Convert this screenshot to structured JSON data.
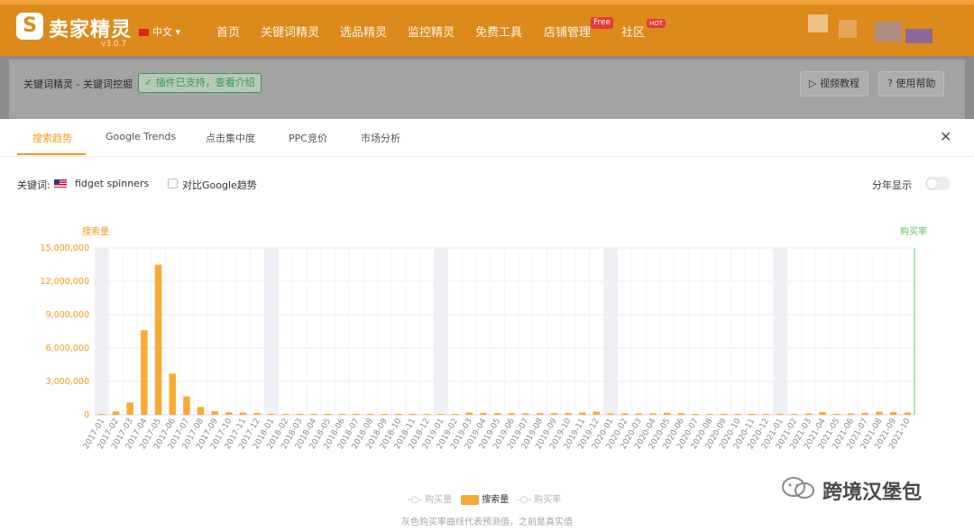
{
  "header": {
    "logo_mark": "S",
    "logo_text": "卖家精灵",
    "version": "v3.0.7",
    "language": "中文",
    "nav": [
      {
        "label": "首页"
      },
      {
        "label": "关键词精灵"
      },
      {
        "label": "选品精灵"
      },
      {
        "label": "监控精灵"
      },
      {
        "label": "免费工具"
      },
      {
        "label": "店铺管理",
        "badge": "Free"
      },
      {
        "label": "社区",
        "badge": "HOT"
      }
    ]
  },
  "subbar": {
    "breadcrumb": "关键词精灵 - 关键词挖掘",
    "plugin_tag": "插件已支持，查看介绍",
    "video_btn": "视频教程",
    "help_btn": "使用帮助"
  },
  "modal": {
    "tabs": [
      "搜索趋势",
      "Google Trends",
      "点击集中度",
      "PPC竞价",
      "市场分析"
    ],
    "active_tab": 0,
    "keyword_label": "关键词:",
    "keyword": "fidget spinners",
    "compare_label": "对比Google趋势",
    "year_toggle_label": "分年显示",
    "legend": [
      "购买量",
      "搜索量",
      "购买率"
    ],
    "footnote": "灰色购买率曲线代表预测值，之前是真实值"
  },
  "chart_data": {
    "type": "bar",
    "y_axis_left_title": "搜索量",
    "y_axis_right_title": "购买率",
    "ylim": [
      0,
      15000000
    ],
    "yticks": [
      "0",
      "3,000,000",
      "6,000,000",
      "9,000,000",
      "12,000,000",
      "15,000,000"
    ],
    "ytick_values": [
      0,
      3000000,
      6000000,
      9000000,
      12000000,
      15000000
    ],
    "series": [
      {
        "name": "搜索量",
        "color": "#f8ab33"
      }
    ],
    "categories": [
      "2017-01",
      "2017-02",
      "2017-03",
      "2017-04",
      "2017-05",
      "2017-06",
      "2017-07",
      "2017-08",
      "2017-09",
      "2017-10",
      "2017-11",
      "2017-12",
      "2018-01",
      "2018-02",
      "2018-03",
      "2018-04",
      "2018-05",
      "2018-06",
      "2018-07",
      "2018-08",
      "2018-09",
      "2018-10",
      "2018-11",
      "2018-12",
      "2019-01",
      "2019-02",
      "2019-03",
      "2019-04",
      "2019-05",
      "2019-06",
      "2019-07",
      "2019-08",
      "2019-09",
      "2019-10",
      "2019-11",
      "2019-12",
      "2020-01",
      "2020-02",
      "2020-03",
      "2020-04",
      "2020-05",
      "2020-06",
      "2020-07",
      "2020-08",
      "2020-09",
      "2020-10",
      "2020-11",
      "2020-12",
      "2021-01",
      "2021-02",
      "2021-03",
      "2021-04",
      "2021-05",
      "2021-06",
      "2021-07",
      "2021-08",
      "2021-09",
      "2021-10"
    ],
    "values": [
      80000,
      300000,
      1100000,
      7600000,
      13500000,
      3700000,
      1650000,
      700000,
      320000,
      230000,
      200000,
      160000,
      90000,
      60000,
      50000,
      45000,
      60000,
      45000,
      40000,
      45000,
      40000,
      40000,
      45000,
      45000,
      50000,
      65000,
      200000,
      160000,
      160000,
      140000,
      130000,
      150000,
      140000,
      160000,
      200000,
      280000,
      120000,
      130000,
      120000,
      130000,
      180000,
      150000,
      40000,
      40000,
      35000,
      40000,
      40000,
      45000,
      25000,
      40000,
      120000,
      250000,
      60000,
      120000,
      170000,
      280000,
      250000,
      200000
    ],
    "shaded_periods": [
      "2017-01",
      "2018-01",
      "2019-01",
      "2020-01",
      "2021-01"
    ],
    "grid": true
  },
  "watermark": {
    "text": "跨境汉堡包",
    "icon": "wechat-icon"
  },
  "colors": {
    "brand": "#dd8a1c",
    "bar": "#f8ab33",
    "accent_tab": "#f39b1a",
    "right_axis": "#5cc85c"
  }
}
